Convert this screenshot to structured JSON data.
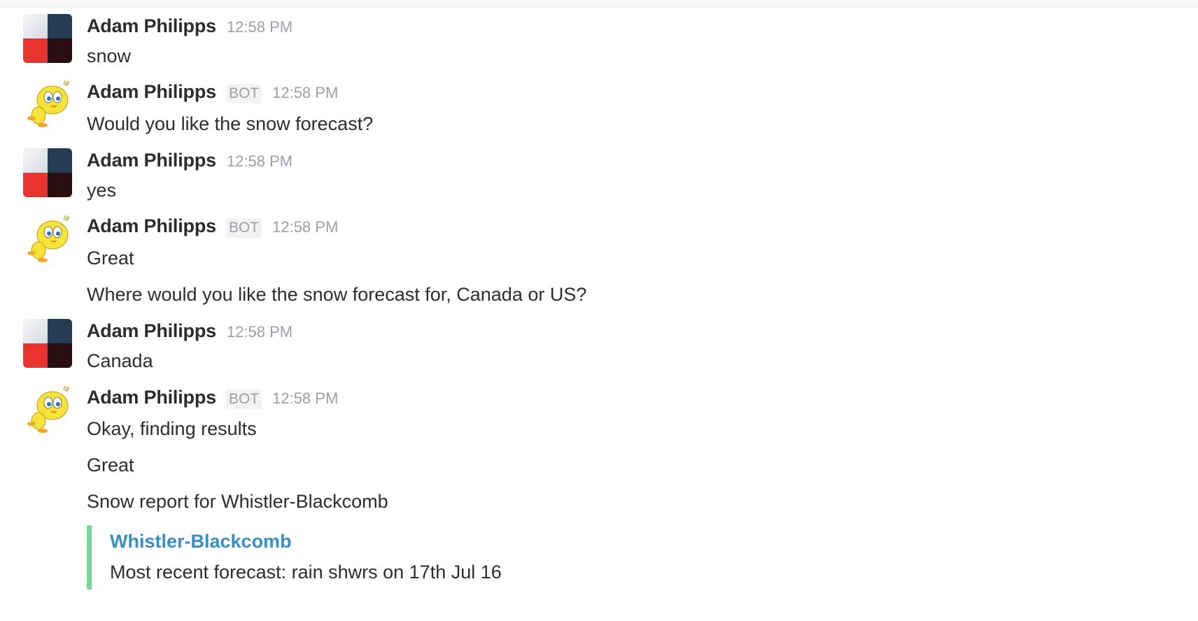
{
  "messages": [
    {
      "author": "Adam Philipps",
      "time": "12:58 PM",
      "bot": false,
      "lines": [
        "snow"
      ]
    },
    {
      "author": "Adam Philipps",
      "badge": "BOT",
      "time": "12:58 PM",
      "bot": true,
      "lines": [
        "Would you like the snow forecast?"
      ]
    },
    {
      "author": "Adam Philipps",
      "time": "12:58 PM",
      "bot": false,
      "lines": [
        "yes"
      ]
    },
    {
      "author": "Adam Philipps",
      "badge": "BOT",
      "time": "12:58 PM",
      "bot": true,
      "lines": [
        "Great",
        "Where would you like the snow forecast for, Canada or US?"
      ]
    },
    {
      "author": "Adam Philipps",
      "time": "12:58 PM",
      "bot": false,
      "lines": [
        "Canada"
      ]
    },
    {
      "author": "Adam Philipps",
      "badge": "BOT",
      "time": "12:58 PM",
      "bot": true,
      "lines": [
        "Okay, finding results",
        "Great",
        "Snow report for Whistler-Blackcomb"
      ]
    }
  ],
  "attachment": {
    "title": "Whistler-Blackcomb",
    "text": "Most recent forecast: rain shwrs on 17th Jul 16",
    "border_color": "#7bd396",
    "title_color": "#3b8ec1"
  },
  "icons": {
    "user_avatar": "user-avatar-icon",
    "bot_avatar": "tweety-bird-icon"
  }
}
